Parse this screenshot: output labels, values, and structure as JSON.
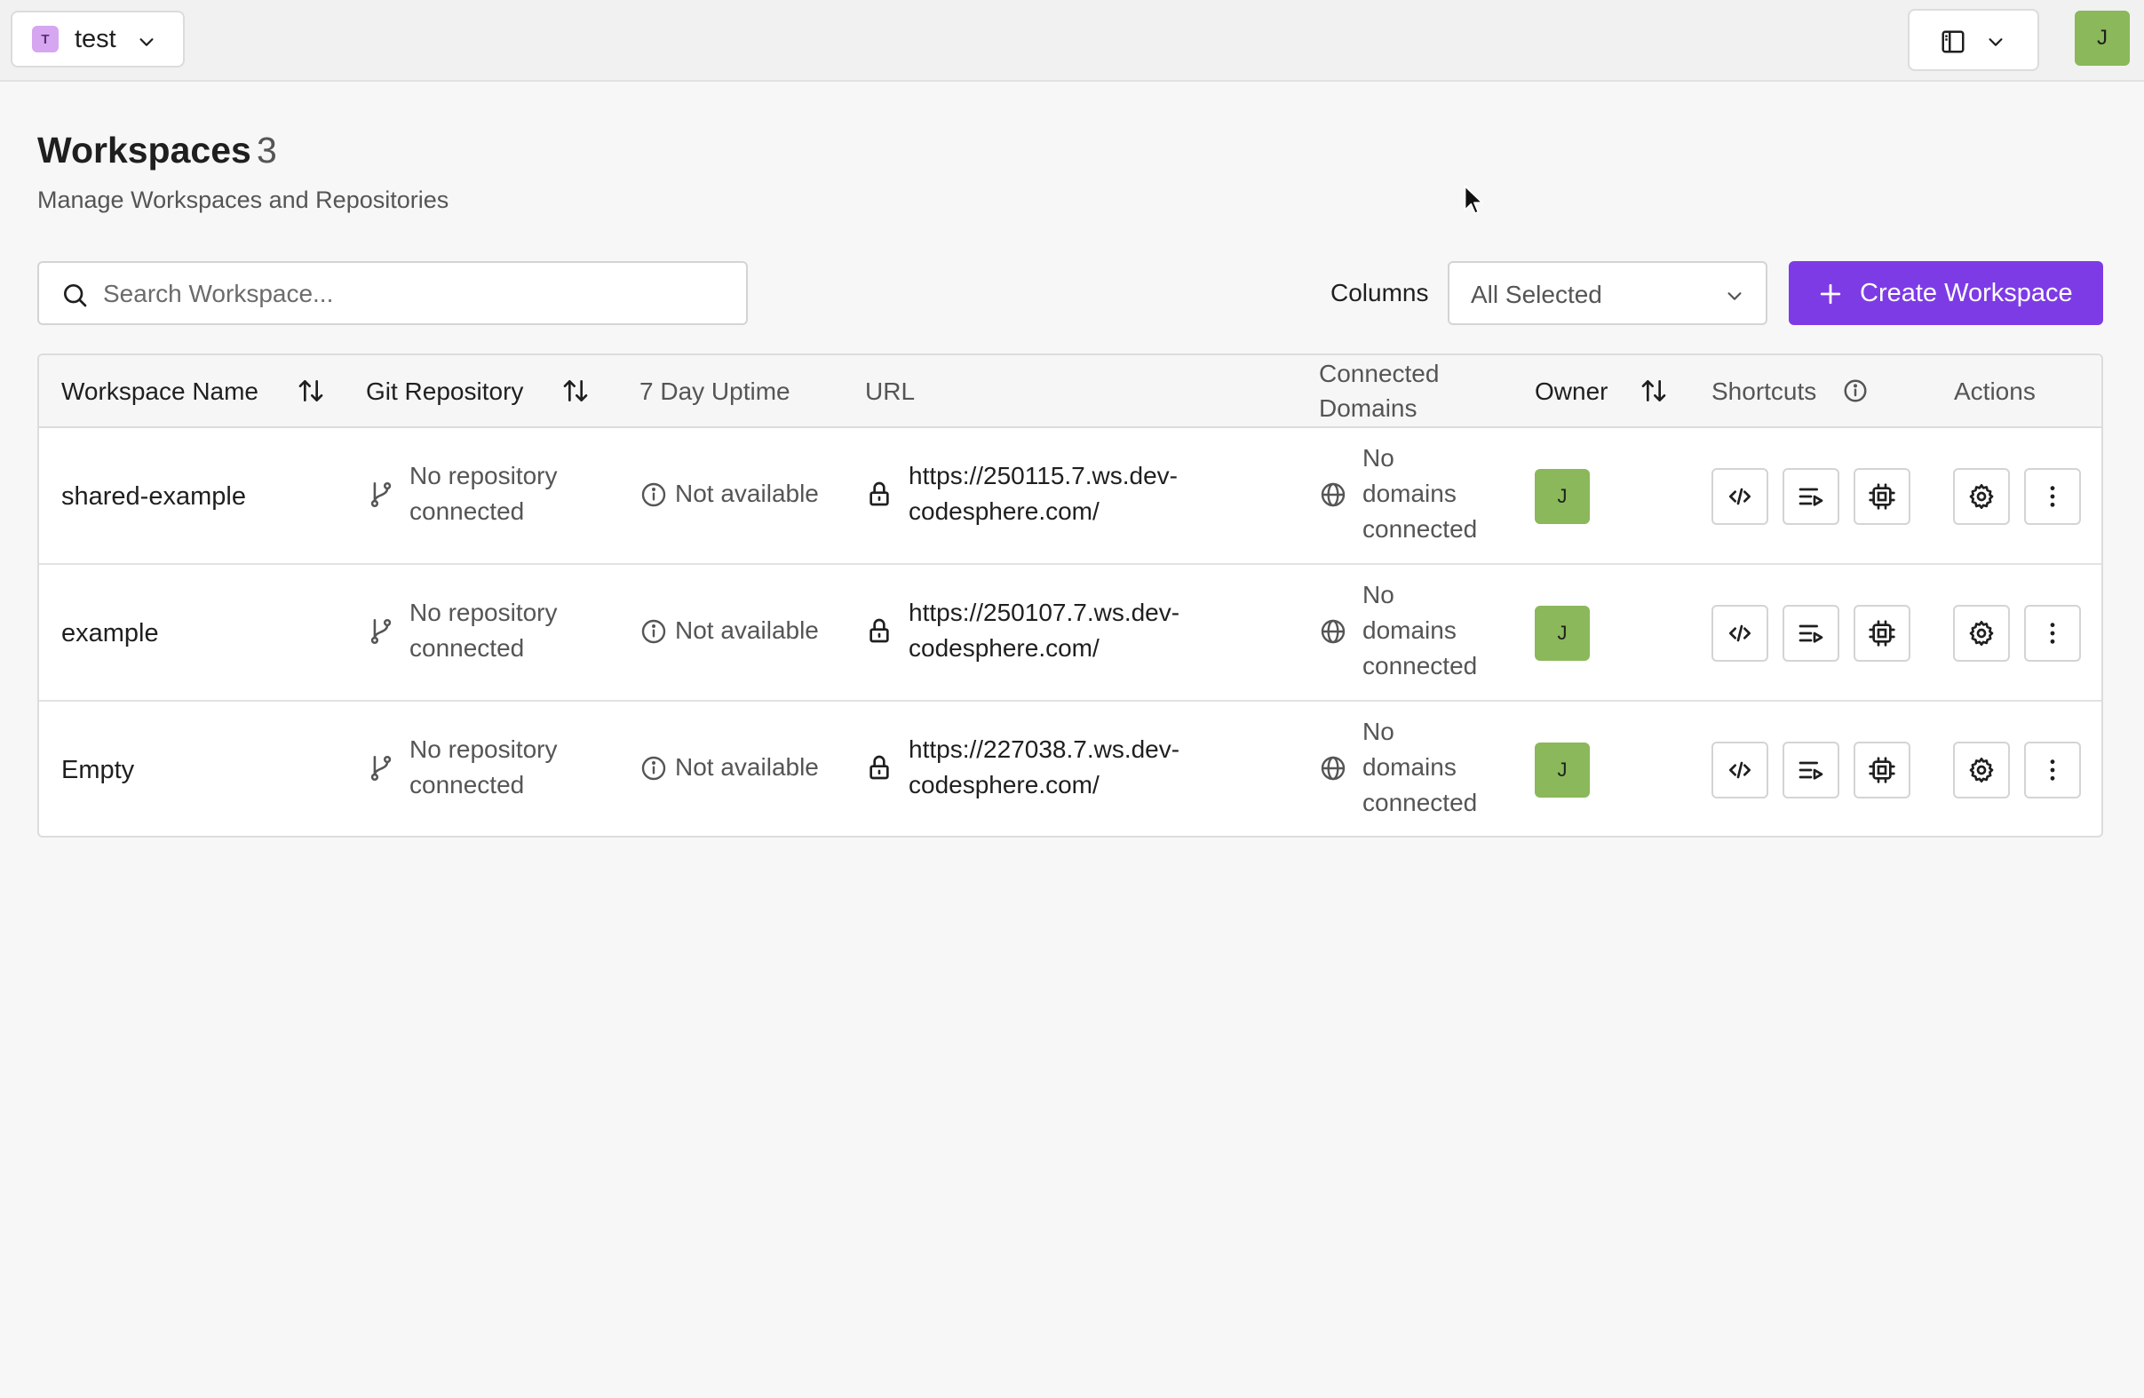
{
  "team": {
    "initial": "T",
    "name": "test"
  },
  "user": {
    "initial": "J"
  },
  "page": {
    "title": "Workspaces",
    "count": "3",
    "subtitle": "Manage Workspaces and Repositories"
  },
  "search": {
    "placeholder": "Search Workspace..."
  },
  "columns": {
    "label": "Columns",
    "value": "All Selected"
  },
  "create_button": {
    "label": "Create Workspace"
  },
  "table": {
    "headers": {
      "name": "Workspace Name",
      "git": "Git Repository",
      "uptime": "7 Day Uptime",
      "url": "URL",
      "domains_1": "Connected",
      "domains_2": "Domains",
      "owner": "Owner",
      "shortcuts": "Shortcuts",
      "actions": "Actions"
    },
    "rows": [
      {
        "name": "shared-example",
        "git_1": "No repository",
        "git_2": "connected",
        "uptime": "Not available",
        "url_1": "https://250115.7.ws.dev-",
        "url_2": "codesphere.com/",
        "dom_1": "No",
        "dom_2": "domains",
        "dom_3": "connected",
        "owner": "J"
      },
      {
        "name": "example",
        "git_1": "No repository",
        "git_2": "connected",
        "uptime": "Not available",
        "url_1": "https://250107.7.ws.dev-",
        "url_2": "codesphere.com/",
        "dom_1": "No",
        "dom_2": "domains",
        "dom_3": "connected",
        "owner": "J"
      },
      {
        "name": "Empty",
        "git_1": "No repository",
        "git_2": "connected",
        "uptime": "Not available",
        "url_1": "https://227038.7.ws.dev-",
        "url_2": "codesphere.com/",
        "dom_1": "No",
        "dom_2": "domains",
        "dom_3": "connected",
        "owner": "J"
      }
    ]
  },
  "colors": {
    "accent": "#7d3be6",
    "avatar": "#8ab85a",
    "team_avatar": "#d6a6f0"
  }
}
